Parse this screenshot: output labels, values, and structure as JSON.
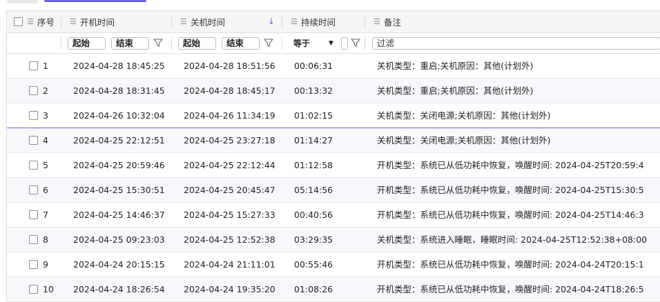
{
  "header": {
    "col_index": "序号",
    "col_power_on": "开机时间",
    "col_power_off": "关机时间",
    "col_duration": "持续时间",
    "col_note": "备注"
  },
  "filters": {
    "on_start": "起始",
    "on_end": "结束",
    "off_start": "起始",
    "off_end": "结束",
    "duration_op": "等于",
    "note_placeholder": "过滤"
  },
  "rows": [
    {
      "idx": "1",
      "on": "2024-04-28 18:45:25",
      "off": "2024-04-28 18:51:56",
      "dur": "00:06:31",
      "note": "关机类型：重启;关机原因：其他(计划外)"
    },
    {
      "idx": "2",
      "on": "2024-04-28 18:31:45",
      "off": "2024-04-28 18:45:17",
      "dur": "00:13:32",
      "note": "关机类型：重启;关机原因：其他(计划外)"
    },
    {
      "idx": "3",
      "on": "2024-04-26 10:32:04",
      "off": "2024-04-26 11:34:19",
      "dur": "01:02:15",
      "note": "关机类型：关闭电源;关机原因：其他(计划外)"
    },
    {
      "idx": "4",
      "on": "2024-04-25 22:12:51",
      "off": "2024-04-25 23:27:18",
      "dur": "01:14:27",
      "note": "关机类型：关闭电源;关机原因：其他(计划外)"
    },
    {
      "idx": "5",
      "on": "2024-04-25 20:59:46",
      "off": "2024-04-25 22:12:44",
      "dur": "01:12:58",
      "note": "开机类型：系统已从低功耗中恢复，唤醒时间: 2024-04-25T20:59:4"
    },
    {
      "idx": "6",
      "on": "2024-04-25 15:30:51",
      "off": "2024-04-25 20:45:47",
      "dur": "05:14:56",
      "note": "开机类型：系统已从低功耗中恢复，唤醒时间: 2024-04-25T15:30:5"
    },
    {
      "idx": "7",
      "on": "2024-04-25 14:46:37",
      "off": "2024-04-25 15:27:33",
      "dur": "00:40:56",
      "note": "开机类型：系统已从低功耗中恢复，唤醒时间: 2024-04-25T14:46:3"
    },
    {
      "idx": "8",
      "on": "2024-04-25 09:23:03",
      "off": "2024-04-25 12:52:38",
      "dur": "03:29:35",
      "note": "关机类型：系统进入睡眠，睡眠时间: 2024-04-25T12:52:38+08:00"
    },
    {
      "idx": "9",
      "on": "2024-04-24 20:15:15",
      "off": "2024-04-24 21:11:01",
      "dur": "00:55:46",
      "note": "开机类型：系统已从低功耗中恢复，唤醒时间: 2024-04-24T20:15:1"
    },
    {
      "idx": "10",
      "on": "2024-04-24 18:26:54",
      "off": "2024-04-24 19:35:20",
      "dur": "01:08:26",
      "note": "开机类型：系统已从低功耗中恢复，唤醒时间: 2024-04-24T18:26:5"
    }
  ]
}
